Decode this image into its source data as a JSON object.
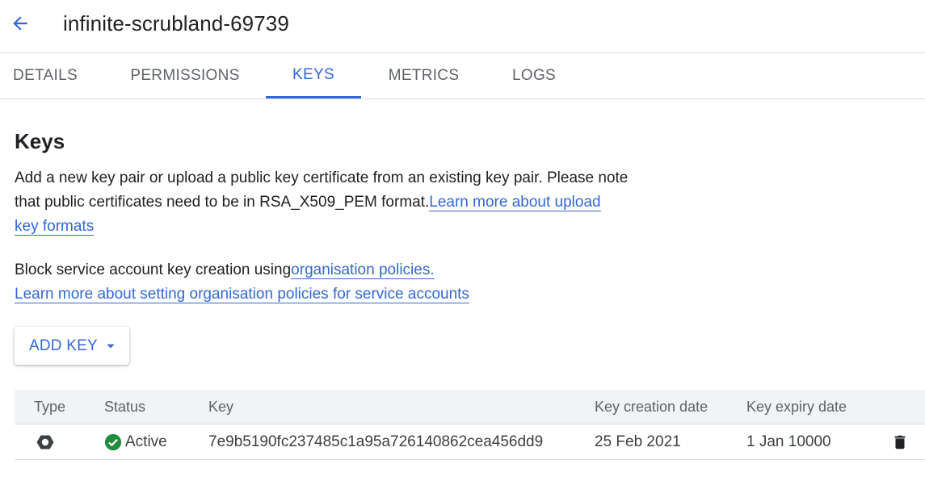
{
  "header": {
    "title": "infinite-scrubland-69739",
    "back_icon": "arrow-back-icon"
  },
  "tabs": [
    {
      "label": "DETAILS",
      "active": false
    },
    {
      "label": "PERMISSIONS",
      "active": false
    },
    {
      "label": "KEYS",
      "active": true
    },
    {
      "label": "METRICS",
      "active": false
    },
    {
      "label": "LOGS",
      "active": false
    }
  ],
  "keys_section": {
    "title": "Keys",
    "description": "Add a new key pair or upload a public key certificate from an existing key pair. Please note that public certificates need to be in RSA_X509_PEM format.",
    "description_link": "Learn more about upload key formats",
    "block_text": "Block service account key creation using",
    "block_link": "organisation policies.",
    "policies_link": "Learn more about setting organisation policies for service accounts",
    "add_key_label": "ADD KEY"
  },
  "table": {
    "headers": [
      "Type",
      "Status",
      "Key",
      "Key creation date",
      "Key expiry date"
    ],
    "rows": [
      {
        "type_icon": "hexagon-icon",
        "status": "Active",
        "key": "7e9b5190fc237485c1a95a726140862cea456dd9",
        "created": "25 Feb 2021",
        "expiry": "1 Jan 10000"
      }
    ]
  },
  "colors": {
    "accent": "#3367d6",
    "active_green": "#1e8e3e",
    "text": "#202124",
    "muted": "#5f6368",
    "divider": "#dadce0",
    "table_header_bg": "#f1f3f4"
  }
}
